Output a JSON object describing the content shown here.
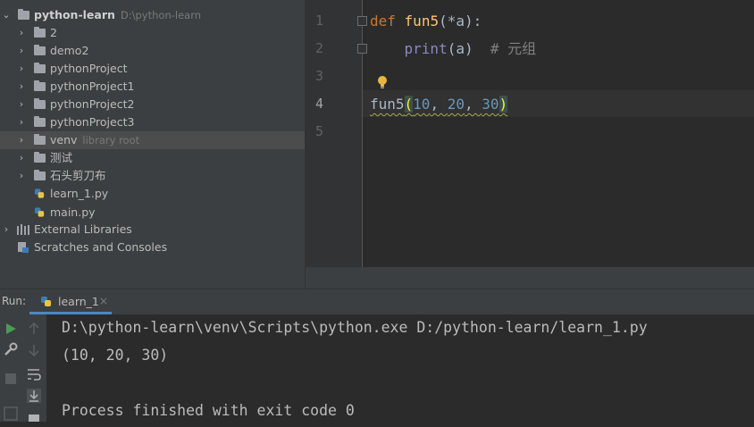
{
  "project_tree": {
    "root": {
      "name": "python-learn",
      "path": "D:\\python-learn"
    },
    "items": [
      {
        "label": "2"
      },
      {
        "label": "demo2"
      },
      {
        "label": "pythonProject"
      },
      {
        "label": "pythonProject1"
      },
      {
        "label": "pythonProject2"
      },
      {
        "label": "pythonProject3"
      },
      {
        "label": "venv",
        "hint": "library root"
      },
      {
        "label": "测试"
      },
      {
        "label": "石头剪刀布"
      },
      {
        "label": "learn_1.py"
      },
      {
        "label": "main.py"
      }
    ],
    "external_libraries": "External Libraries",
    "scratches": "Scratches and Consoles"
  },
  "editor": {
    "line_numbers": [
      "1",
      "2",
      "3",
      "4",
      "5"
    ],
    "code": {
      "l1_kw": "def",
      "l1_fn": "fun5",
      "l1_params": "(*a):",
      "l2_builtin": "print",
      "l2_args": "(a)",
      "l2_comment": "# 元组",
      "l4_call": "fun5",
      "l4_open": "(",
      "l4_n1": "10",
      "l4_sep1": ", ",
      "l4_n2": "20",
      "l4_sep2": ", ",
      "l4_n3": "30",
      "l4_close": ")"
    }
  },
  "run": {
    "title": "Run:",
    "tab_label": "learn_1",
    "tab_close": "×",
    "console": [
      "D:\\python-learn\\venv\\Scripts\\python.exe D:/python-learn/learn_1.py",
      "(10, 20, 30)",
      "",
      "Process finished with exit code 0"
    ]
  },
  "colors": {
    "accent": "#4a88c7",
    "keyword": "#cc7832",
    "function": "#ffc66d",
    "number": "#6897bb",
    "run_green": "#499c54"
  }
}
